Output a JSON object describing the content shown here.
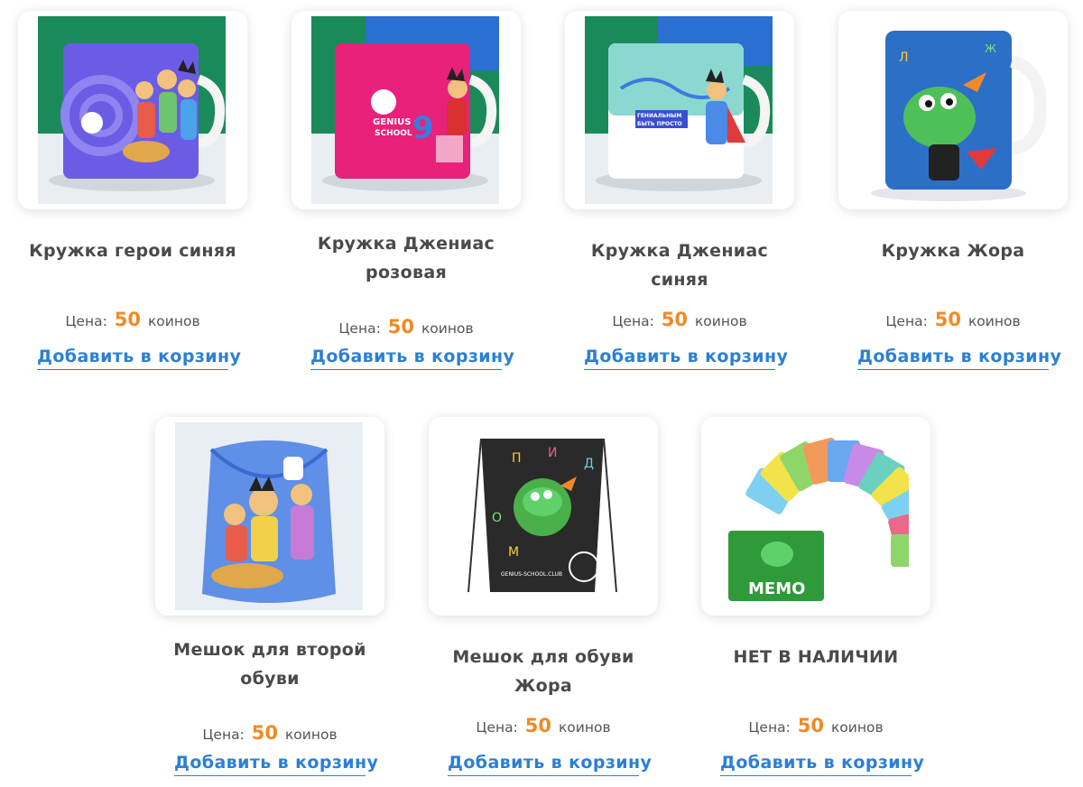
{
  "products": [
    {
      "title": "Кружка герои синяя",
      "price_label": "Цена:",
      "price": "50",
      "currency": "коинов",
      "cta": "Добавить в корзину",
      "image": "mug-heroes-blue"
    },
    {
      "title": "Кружка Джениас розовая",
      "price_label": "Цена:",
      "price": "50",
      "currency": "коинов",
      "cta": "Добавить в корзину",
      "image": "mug-genius-pink",
      "image_text": [
        "GENIUS",
        "SCHOOL",
        "9"
      ]
    },
    {
      "title": "Кружка Джениас синяя",
      "price_label": "Цена:",
      "price": "50",
      "currency": "коинов",
      "cta": "Добавить в корзину",
      "image": "mug-genius-blue",
      "image_text": [
        "ГЕНИАЛЬНЫМ",
        "БЫТЬ ПРОСТО"
      ]
    },
    {
      "title": "Кружка Жора",
      "price_label": "Цена:",
      "price": "50",
      "currency": "коинов",
      "cta": "Добавить в корзину",
      "image": "mug-zhora"
    },
    {
      "title": "Мешок для второй обуви",
      "price_label": "Цена:",
      "price": "50",
      "currency": "коинов",
      "cta": "Добавить в корзину",
      "image": "bag-heroes"
    },
    {
      "title": "Мешок для обуви Жора",
      "price_label": "Цена:",
      "price": "50",
      "currency": "коинов",
      "cta": "Добавить в корзину",
      "image": "bag-zhora-black",
      "image_text": [
        "GENIUS-SCHOOL.CLUB"
      ]
    },
    {
      "title": "НЕТ В НАЛИЧИИ",
      "price_label": "Цена:",
      "price": "50",
      "currency": "коинов",
      "cta": "Добавить в корзину",
      "image": "memo-cards",
      "image_text": [
        "МЕМО"
      ]
    }
  ],
  "colors": {
    "accent_price": "#f08a24",
    "link": "#2b7fd6",
    "title": "#4a4a4a"
  }
}
